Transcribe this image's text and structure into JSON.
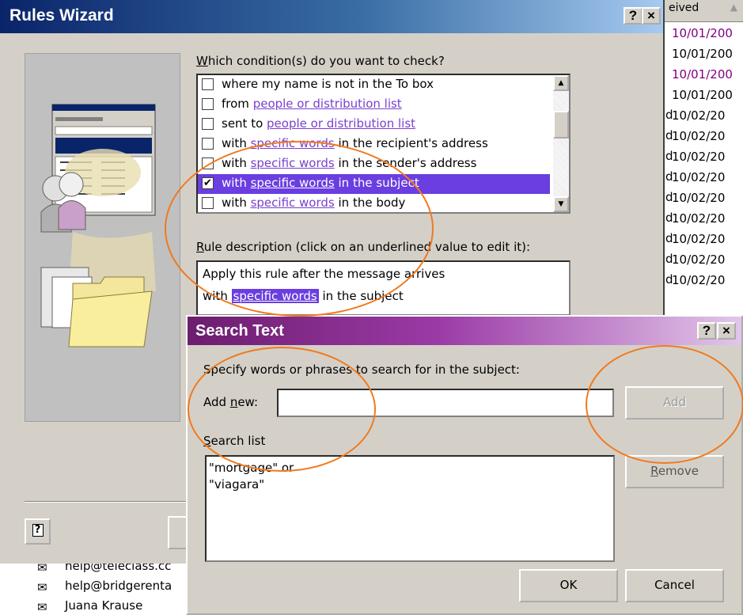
{
  "background_list": {
    "column_header": "eived",
    "rows": [
      {
        "flag": "",
        "date": "10/01/200",
        "color": "#800080"
      },
      {
        "flag": "",
        "date": "10/01/200",
        "color": "#000000"
      },
      {
        "flag": "",
        "date": "10/01/200",
        "color": "#800080"
      },
      {
        "flag": "",
        "date": "10/01/200",
        "color": "#000000"
      },
      {
        "flag": "d",
        "date": "10/02/20",
        "color": "#000000"
      },
      {
        "flag": "d",
        "date": "10/02/20",
        "color": "#000000"
      },
      {
        "flag": "d",
        "date": "10/02/20",
        "color": "#000000"
      },
      {
        "flag": "d",
        "date": "10/02/20",
        "color": "#000000"
      },
      {
        "flag": "d",
        "date": "10/02/20",
        "color": "#000000"
      },
      {
        "flag": "d",
        "date": "10/02/20",
        "color": "#000000"
      },
      {
        "flag": "d",
        "date": "10/02/20",
        "color": "#000000"
      },
      {
        "flag": "d",
        "date": "10/02/20",
        "color": "#000000"
      },
      {
        "flag": "d",
        "date": "10/02/20",
        "color": "#000000"
      }
    ],
    "bottom_senders": [
      "help@teleclass.cc",
      "help@bridgerenta",
      "Juana Krause"
    ]
  },
  "rules_wizard": {
    "title": "Rules Wizard",
    "help_button": "?",
    "close_button": "×",
    "condition_prompt_prefix": "",
    "condition_prompt_mnemonic": "W",
    "condition_prompt_rest": "hich condition(s) do you want to check?",
    "conditions": [
      {
        "checked": false,
        "pre": "where my name is not in the To box",
        "link": "",
        "post": ""
      },
      {
        "checked": false,
        "pre": "from ",
        "link": "people or distribution list",
        "post": ""
      },
      {
        "checked": false,
        "pre": "sent to ",
        "link": "people or distribution list",
        "post": ""
      },
      {
        "checked": false,
        "pre": "with ",
        "link": "specific words",
        "post": " in the recipient's address"
      },
      {
        "checked": false,
        "pre": "with ",
        "link": "specific words",
        "post": " in the sender's address"
      },
      {
        "checked": true,
        "pre": "with ",
        "link": "specific words",
        "post": " in the subject"
      },
      {
        "checked": false,
        "pre": "with ",
        "link": "specific words",
        "post": " in the body"
      }
    ],
    "selected_index": 5,
    "description_label_mnemonic": "R",
    "description_label_rest": "ule description (click on an underlined value to edit it):",
    "description_line1": "Apply this rule after the message arrives",
    "description_line2_pre": "with ",
    "description_line2_link": "specific words",
    "description_line2_post": " in the subject",
    "help_icon": "?"
  },
  "search_text": {
    "title": "Search Text",
    "help_button": "?",
    "close_button": "×",
    "instruction": "Specify words or phrases to search for in the subject:",
    "add_new_label_pre": "Add ",
    "add_new_label_mnemonic": "n",
    "add_new_label_post": "ew:",
    "add_new_value": "",
    "add_button": "Add",
    "search_list_mnemonic": "S",
    "search_list_rest": "earch list",
    "search_list_items": [
      "\"mortgage\" or",
      "\"viagara\""
    ],
    "remove_button_mnemonic": "R",
    "remove_button_rest": "emove",
    "ok_button": "OK",
    "cancel_button": "Cancel"
  },
  "annotation_color": "#f07a1e"
}
